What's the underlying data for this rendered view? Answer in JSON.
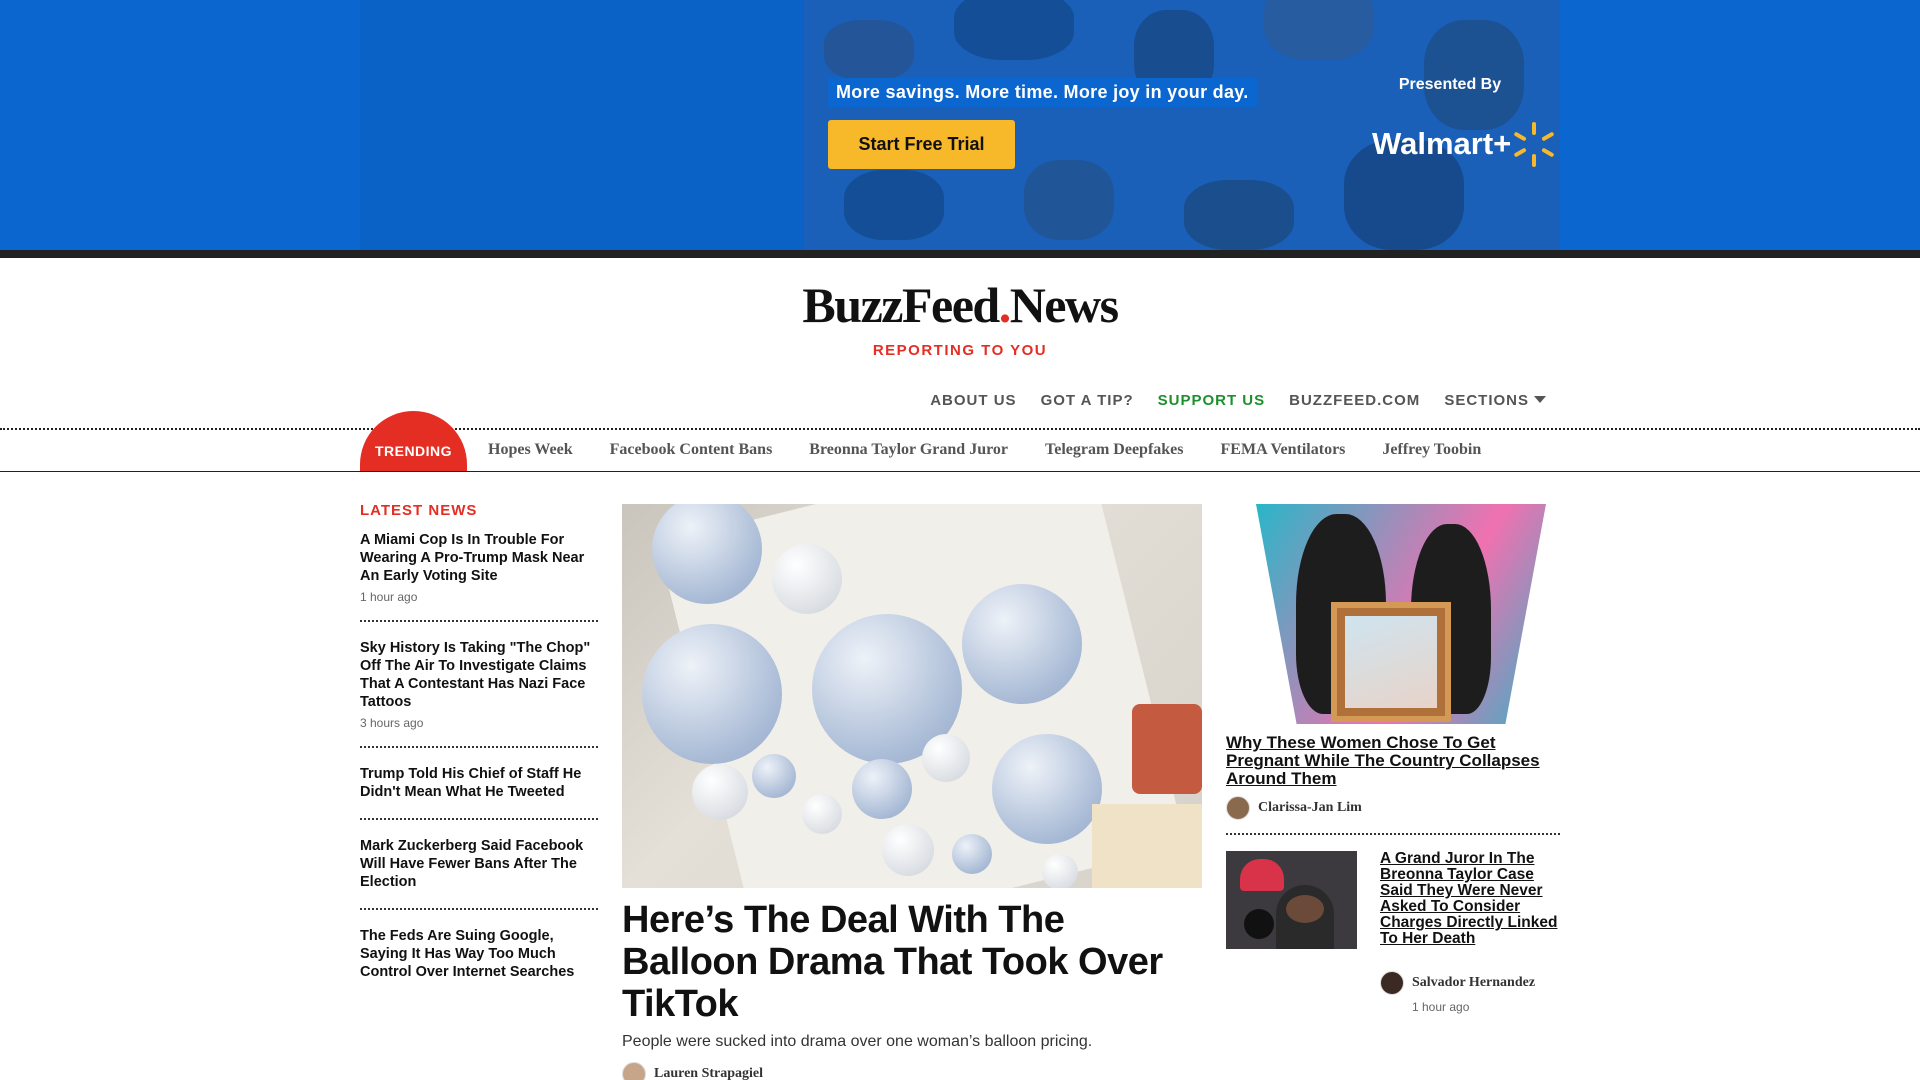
{
  "ad": {
    "tagline": "More savings. More time. More joy in your day.",
    "cta_label": "Start Free Trial",
    "presented_by": "Presented By",
    "sponsor_logo_text": "Walmart+",
    "colors": {
      "background": "#0b66cf",
      "cta": "#f7b829"
    }
  },
  "brand": {
    "logo_part1": "BuzzFeed",
    "logo_dot": ".",
    "logo_part2": "News",
    "tagline": "REPORTING TO YOU",
    "colors": {
      "accent": "#e42e24",
      "support": "#1f8f2e"
    }
  },
  "topnav": {
    "items": [
      "ABOUT US",
      "GOT A TIP?",
      "SUPPORT US",
      "BUZZFEED.COM",
      "SECTIONS"
    ]
  },
  "trending": {
    "label": "TRENDING",
    "links": [
      "Hopes Week",
      "Facebook Content Bans",
      "Breonna Taylor Grand Juror",
      "Telegram Deepfakes",
      "FEMA Ventilators",
      "Jeffrey Toobin"
    ]
  },
  "latest_news": {
    "heading": "LATEST NEWS",
    "items": [
      {
        "title": "A Miami Cop Is In Trouble For Wearing A Pro-Trump Mask Near An Early Voting Site",
        "time": "1 hour ago"
      },
      {
        "title": "Sky History Is Taking \"The Chop\" Off The Air To Investigate Claims That A Contestant Has Nazi Face Tattoos",
        "time": "3 hours ago"
      },
      {
        "title": "Trump Told His Chief of Staff He Didn't Mean What He Tweeted",
        "time": ""
      },
      {
        "title": "Mark Zuckerberg Said Facebook Will Have Fewer Bans After The Election",
        "time": ""
      },
      {
        "title": "The Feds Are Suing Google, Saying It Has Way Too Much Control Over Internet Searches",
        "time": ""
      }
    ]
  },
  "feature": {
    "title": "Here’s The Deal With The Balloon Drama That Took Over TikTok",
    "dek": "People were sucked into drama over one woman’s balloon pricing.",
    "author": "Lauren Strapagiel"
  },
  "right_rail": {
    "story1": {
      "title": "Why These Women Chose To Get Pregnant While The Country Collapses Around Them",
      "author": "Clarissa-Jan Lim"
    },
    "story2": {
      "title": "A Grand Juror In The Breonna Taylor Case Said They Were Never Asked To Consider Charges Directly Linked To Her Death",
      "author": "Salvador Hernandez",
      "time": "1 hour ago"
    }
  }
}
